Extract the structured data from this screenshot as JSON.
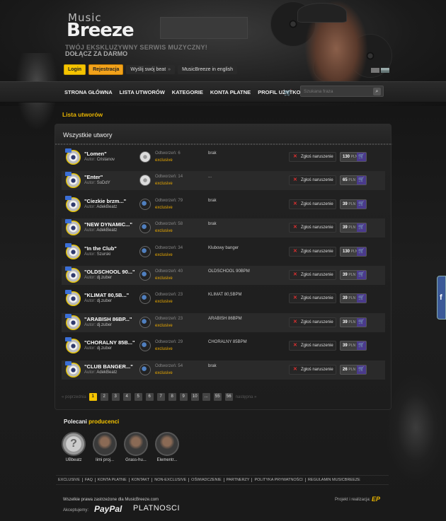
{
  "brand": {
    "logo_top": "Music",
    "logo_main": "Breeze",
    "tagline": "TWÓJ EKSKLUZYWNY SERWIS MUZYCZNY!",
    "join": "DOŁĄCZ ZA DARMO"
  },
  "topbar": {
    "login": "Login",
    "register": "Rejestracja",
    "send_beat": "Wyślij swój beat",
    "english": "MusicBreeze in english"
  },
  "nav": {
    "items": [
      "STRONA GŁÓWNA",
      "LISTA UTWORÓW",
      "KATEGORIE",
      "KONTA PŁATNE",
      "PROFIL UŻYTKOWNIKA"
    ],
    "search_placeholder": "Szukana fraza"
  },
  "section_title": "Lista utworów",
  "panel_title": "Wszystkie utwory",
  "labels": {
    "author": "Autor:",
    "plays": "Odtworzeń:",
    "report": "Zgłoś naruszenie",
    "currency": "PLN"
  },
  "tracks": [
    {
      "title": "\"Lomen\"",
      "author": "Cristanov",
      "plays": "6",
      "tag": "exclusive",
      "desc": "brak",
      "price": "130"
    },
    {
      "title": "\"Enter\"",
      "author": "SoDdY",
      "plays": "14",
      "tag": "exclusive",
      "desc": "...",
      "price": "65"
    },
    {
      "title": "\"Ciezkie brzm...\"",
      "author": "AdekBeatz",
      "plays": "79",
      "tag": "exclusive",
      "desc": "brak",
      "price": "39"
    },
    {
      "title": "\"NEW DYNAMIC...\"",
      "author": "AdekBeatz",
      "plays": "58",
      "tag": "exclusive",
      "desc": "brak",
      "price": "39"
    },
    {
      "title": "\"In the Club\"",
      "author": "Szurski",
      "plays": "34",
      "tag": "exclusive",
      "desc": "Klubowy banger",
      "price": "130"
    },
    {
      "title": "\"OLDSCHOOL 90...\"",
      "author": "dj.zuber",
      "plays": "40",
      "tag": "exclusive",
      "desc": "OLDSCHOOL 90BPM",
      "price": "39"
    },
    {
      "title": "\"KLIMAT 80,5B...\"",
      "author": "dj.zuber",
      "plays": "23",
      "tag": "exclusive",
      "desc": "KLIMAT 80,5BPM",
      "price": "39"
    },
    {
      "title": "\"ARABISH 86BP...\"",
      "author": "dj.zuber",
      "plays": "23",
      "tag": "exclusive",
      "desc": "ARABISH 86BPM",
      "price": "39"
    },
    {
      "title": "\"CHORALNY 85B...\"",
      "author": "dj.zuber",
      "plays": "29",
      "tag": "exclusive",
      "desc": "CHORALNY 85BPM",
      "price": "39"
    },
    {
      "title": "\"CLUB BANGER...\"",
      "author": "AdekBeatz",
      "plays": "54",
      "tag": "exclusive",
      "desc": "brak",
      "price": "26"
    }
  ],
  "pager": {
    "prev": "« poprzednia",
    "next": "następna »",
    "pages": [
      "1",
      "2",
      "3",
      "4",
      "5",
      "6",
      "7",
      "8",
      "9",
      "10",
      "...",
      "55",
      "56"
    ],
    "active": "1"
  },
  "producers": {
    "title_a": "Polecani",
    "title_b": "producenci",
    "items": [
      "UBbeatz",
      "Iimi proj...",
      "Grass-hu...",
      "Elementr..."
    ]
  },
  "footer": {
    "links": [
      "EXCLUSIVE",
      "FAQ",
      "KONTA PŁATNE",
      "KONTAKT",
      "NON-EXCLUSIVE",
      "OŚWIADCZENIE",
      "PARTNERZY",
      "POLITYKA PRYWATNOŚCI",
      "REGULAMIN MUSICBREEZE"
    ],
    "copyright": "Wszelkie prawa zastrzeżone dla",
    "domain": "MusicBreeze.com",
    "realization": "Projekt i realizacja:",
    "accept": "Akceptujemy:",
    "paypal": "PayPal",
    "platnosci": "PLATNOSCI"
  },
  "colors": {
    "accent": "#f5c400",
    "cart": "#4a3a8c",
    "facebook": "#3b5998"
  }
}
